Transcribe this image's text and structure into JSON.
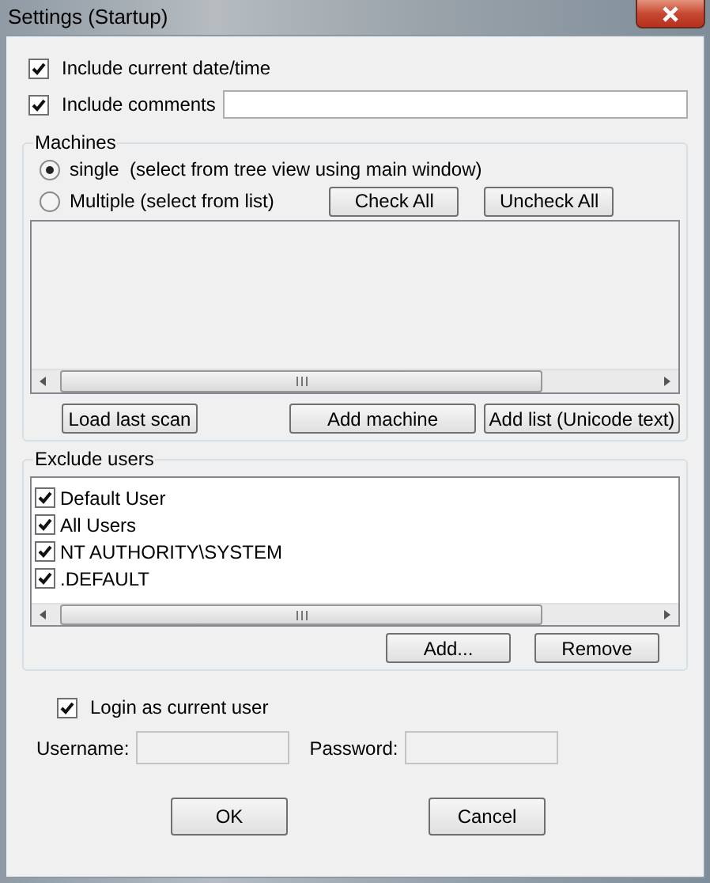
{
  "window": {
    "title": "Settings (Startup)"
  },
  "options": [
    {
      "label": "Include current date/time",
      "checked": true,
      "kind": "plain"
    },
    {
      "label": "Include comments",
      "checked": true,
      "kind": "with-field"
    }
  ],
  "machines": {
    "title": "Machines",
    "modes": [
      {
        "label": "single  (select from tree view using main window)",
        "selected": true
      },
      {
        "label": "Multiple (select from list)",
        "selected": false
      }
    ],
    "mode_buttons": [
      "Check All",
      "Uncheck All"
    ],
    "list_buttons": [
      "Load last scan",
      "Add machine",
      "Add list (Unicode text)"
    ]
  },
  "exclude_users": {
    "title": "Exclude users",
    "users": [
      {
        "name": "Default User",
        "checked": true
      },
      {
        "name": "All Users",
        "checked": true
      },
      {
        "name": "NT AUTHORITY\\SYSTEM",
        "checked": true
      },
      {
        "name": ".DEFAULT",
        "checked": true
      }
    ],
    "buttons": [
      "Add...",
      "Remove"
    ]
  },
  "login": {
    "label": "Login as current user",
    "checked": true,
    "username_label": "Username:",
    "password_label": "Password:"
  },
  "buttons": [
    "OK",
    "Cancel"
  ]
}
